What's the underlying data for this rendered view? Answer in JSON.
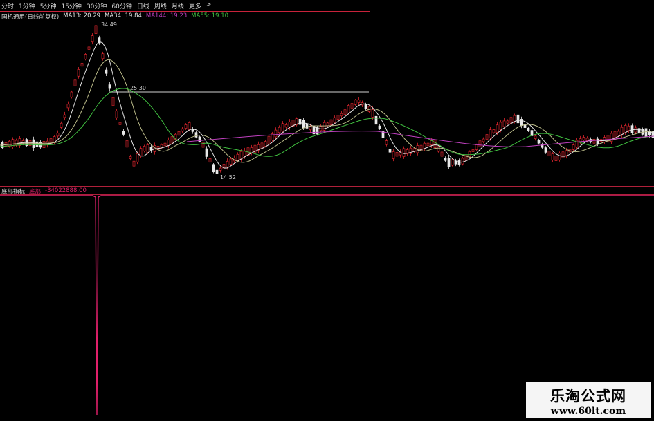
{
  "period_tabs": [
    "分时",
    "1分钟",
    "5分钟",
    "15分钟",
    "30分钟",
    "60分钟",
    "日线",
    "周线",
    "月线",
    "更多",
    ">"
  ],
  "ma_legend": {
    "stock": "国机通用(日线前复权)",
    "items": [
      {
        "text": "MA13: 20.29",
        "color": "#e6e6e6"
      },
      {
        "text": "MA34: 19.84",
        "color": "#e6e6e6"
      },
      {
        "text": "MA144: 19.23",
        "color": "#c040c0"
      },
      {
        "text": "MA55: 19.10",
        "color": "#40c040"
      }
    ]
  },
  "price_annotations": {
    "high": "34.49",
    "resistance": "25.30",
    "low": "14.52"
  },
  "indicator": {
    "name": "底部指标",
    "label": "底部",
    "value": "-34022888.00"
  },
  "watermark": {
    "title": "乐淘公式网",
    "url": "www.60lt.com"
  },
  "colors": {
    "up": "#e0262e",
    "down": "#e8e8e8",
    "ma13": "#e6e6e6",
    "ma34": "#bdbd8a",
    "ma55": "#40c040",
    "ma144": "#c040c0",
    "indicator": "#e0206a",
    "divider": "#b0203a"
  }
}
